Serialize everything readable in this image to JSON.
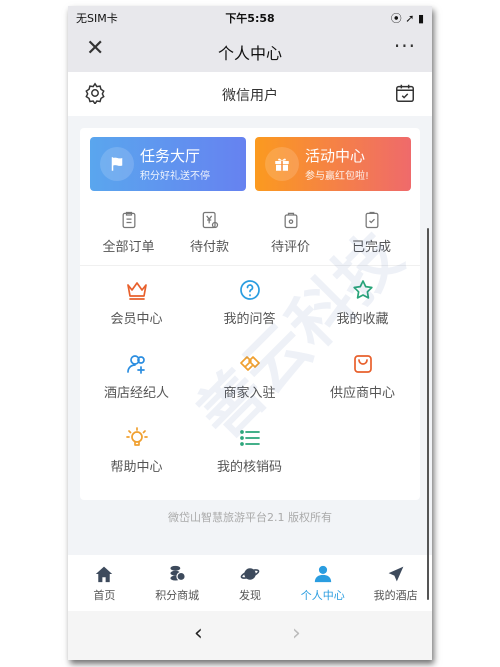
{
  "status": {
    "carrier": "无SIM卡",
    "time": "下午5:58",
    "right": "⦿ ➚ ▮"
  },
  "nav": {
    "title": "个人中心",
    "close": "✕",
    "more": "···"
  },
  "header": {
    "username": "微信用户"
  },
  "banners": [
    {
      "title": "任务大厅",
      "subtitle": "积分好礼送不停",
      "icon": "flag-icon"
    },
    {
      "title": "活动中心",
      "subtitle": "参与赢红包啦!",
      "icon": "gift-icon"
    }
  ],
  "orders": [
    {
      "label": "全部订单"
    },
    {
      "label": "待付款"
    },
    {
      "label": "待评价"
    },
    {
      "label": "已完成"
    }
  ],
  "grid": [
    {
      "label": "会员中心",
      "icon": "crown-icon",
      "color": "#e8602c"
    },
    {
      "label": "我的问答",
      "icon": "question-icon",
      "color": "#2a9de0"
    },
    {
      "label": "我的收藏",
      "icon": "star-icon",
      "color": "#2aa57a"
    },
    {
      "label": "酒店经纪人",
      "icon": "add-user-icon",
      "color": "#2a8de0"
    },
    {
      "label": "商家入驻",
      "icon": "handshake-icon",
      "color": "#f0a030"
    },
    {
      "label": "供应商中心",
      "icon": "bag-icon",
      "color": "#e8602c"
    },
    {
      "label": "帮助中心",
      "icon": "bulb-icon",
      "color": "#f0a030"
    },
    {
      "label": "我的核销码",
      "icon": "list-icon",
      "color": "#2aa57a"
    }
  ],
  "footer": "微岱山智慧旅游平台2.1 版权所有",
  "tabs": [
    {
      "label": "首页"
    },
    {
      "label": "积分商城"
    },
    {
      "label": "发现"
    },
    {
      "label": "个人中心",
      "active": true
    },
    {
      "label": "我的酒店"
    }
  ],
  "accent": "#2a9de0",
  "watermark": "善云科技",
  "bottom": {
    "back": "‹",
    "forward": "›"
  }
}
